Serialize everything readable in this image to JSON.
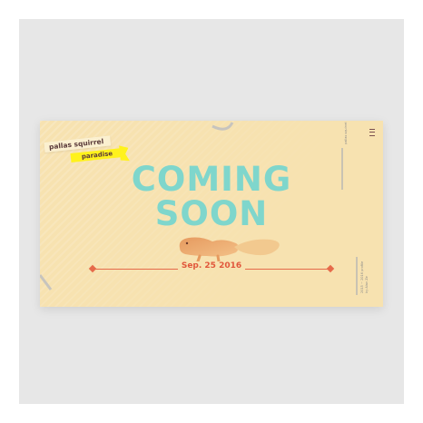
{
  "ribbon": {
    "line1": "pallas squirrel",
    "line2": "paradise"
  },
  "heading": {
    "line1": "COMING",
    "line2": "SOON"
  },
  "event": {
    "date": "Sep. 25 2016"
  },
  "colors": {
    "background": "#f7e2b0",
    "title": "#7fd6cc",
    "title_accent": "#7f86b2",
    "accent": "#e66a4a",
    "ribbon_yellow": "#fff21c"
  },
  "icons": [
    "menu-icon",
    "squirrel-illustration",
    "diamond-icon"
  ],
  "footer_vertical": {
    "line1": "2015 ~ 2016 profile",
    "line2": "by Alan Ze"
  }
}
